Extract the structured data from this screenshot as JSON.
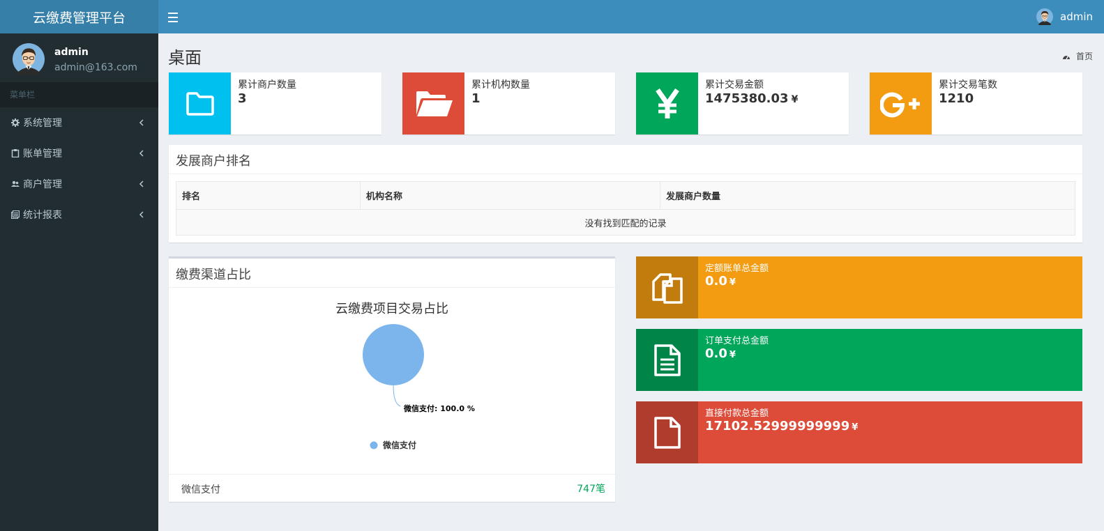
{
  "app": {
    "title": "云缴费管理平台"
  },
  "navbar": {
    "username": "admin"
  },
  "sidebar": {
    "user_name": "admin",
    "user_email": "admin@163.com",
    "menu_header": "菜单栏",
    "items": [
      {
        "label": "系统管理",
        "icon": "gear-icon"
      },
      {
        "label": "账单管理",
        "icon": "clipboard-icon"
      },
      {
        "label": "商户管理",
        "icon": "users-icon"
      },
      {
        "label": "统计报表",
        "icon": "report-icon"
      }
    ]
  },
  "page": {
    "title": "桌面",
    "breadcrumb": "首页"
  },
  "info_boxes": [
    {
      "label": "累计商户数量",
      "value": "3",
      "unit": "",
      "color": "#00c0ef",
      "icon": "folder-icon"
    },
    {
      "label": "累计机构数量",
      "value": "1",
      "unit": "",
      "color": "#dd4b39",
      "icon": "folder-open-icon"
    },
    {
      "label": "累计交易金额",
      "value": "1475380.03",
      "unit": "¥",
      "color": "#00a65a",
      "icon": "yen-icon"
    },
    {
      "label": "累计交易笔数",
      "value": "1210",
      "unit": "",
      "color": "#f39c12",
      "icon": "google-plus-icon"
    }
  ],
  "rank_table": {
    "title": "发展商户排名",
    "columns": [
      "排名",
      "机构名称",
      "发展商户数量"
    ],
    "empty_text": "没有找到匹配的记录"
  },
  "channel_box": {
    "title": "缴费渠道占比",
    "footer_label": "微信支付",
    "footer_count": "747笔"
  },
  "chart_data": {
    "type": "pie",
    "title": "云缴费项目交易占比",
    "labels": [
      "微信支付"
    ],
    "values": [
      100.0
    ],
    "data_labels": [
      "微信支付: 100.0 %"
    ],
    "colors": [
      "#7cb5ec"
    ],
    "legend": [
      "微信支付"
    ],
    "legend_position": "bottom"
  },
  "stat_boxes": [
    {
      "label": "定额账单总金额",
      "value": "0.0",
      "unit": "¥",
      "color": "#f39c12",
      "icon": "copy-icon"
    },
    {
      "label": "订单支付总金额",
      "value": "0.0",
      "unit": "¥",
      "color": "#00a65a",
      "icon": "file-text-icon"
    },
    {
      "label": "直接付款总金额",
      "value": "17102.52999999999",
      "unit": "¥",
      "color": "#dd4b39",
      "icon": "file-icon"
    }
  ]
}
